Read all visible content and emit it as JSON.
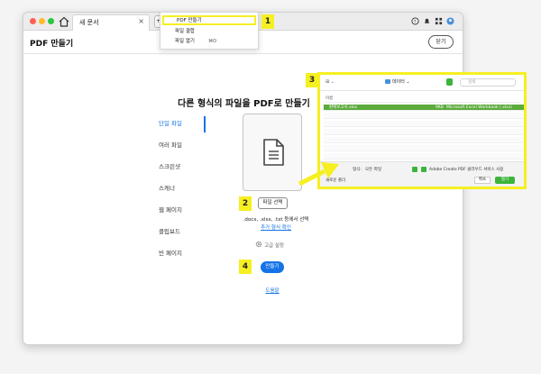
{
  "titlebar": {
    "tab_label": "새 문서",
    "tab_close": "×",
    "create_button": "+ 만들기"
  },
  "page": {
    "title": "PDF 만들기",
    "close_button": "닫기",
    "heading": "다른 형식의 파일을 PDF로 만들기"
  },
  "dropdown": {
    "items": [
      {
        "label": "PDF 만들기",
        "shortcut": ""
      },
      {
        "label": "파일 결합",
        "shortcut": ""
      },
      {
        "label": "파일 열기",
        "shortcut": "⌘O"
      }
    ]
  },
  "sidebar": {
    "items": [
      {
        "label": "단일 파일"
      },
      {
        "label": "여러 파일"
      },
      {
        "label": "스크린샷"
      },
      {
        "label": "스캐너"
      },
      {
        "label": "웹 페이지"
      },
      {
        "label": "클립보드"
      },
      {
        "label": "빈 페이지"
      }
    ]
  },
  "main": {
    "select_file_button": "파일 선택",
    "formats_text": ".docx, .xlsx, .txt 등에서 선택",
    "more_formats_link": "추가 형식 확인",
    "advanced_settings": "고급 설정",
    "create_button": "만들기",
    "help_link": "도움말"
  },
  "callouts": [
    "1",
    "2",
    "3",
    "4"
  ],
  "dialog": {
    "view_label": "⊞ ⌄",
    "folder": "데이터 ⌄",
    "search_placeholder": "검색",
    "column_header": "이름",
    "selected_file": "판매보고서.xlsx",
    "selected_size": "9KB",
    "selected_kind": "Microsoft Excel Workbook (.xlsx)",
    "format_label": "형식:",
    "format_value": "모든 파일",
    "option_label": "Adobe Create PDF 클라우드 서비스 사용",
    "new_folder": "새로운 폴더",
    "cancel": "취소",
    "open": "열기"
  },
  "colors": {
    "accent": "#1473e6",
    "highlight": "#f6ef21",
    "dialog_select": "#5cab3c"
  }
}
